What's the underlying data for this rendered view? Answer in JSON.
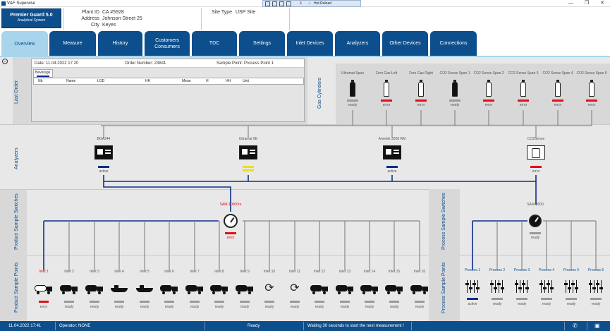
{
  "window": {
    "title": "V&F Supervise"
  },
  "debug_toolbar": {
    "count": "4",
    "hot_reload": "Hot Reload"
  },
  "header": {
    "logo_line1": "Premier Guard 5.0",
    "logo_line2": "Analytical System",
    "plant_id_label": "Plant ID",
    "plant_id_value": "CA #5928",
    "address_label": "Address",
    "address_value": "Johnson Street 25",
    "city_label": "City",
    "city_value": "Keyes",
    "site_type_label": "Site Type",
    "site_type_value": "USP Site"
  },
  "tabs": [
    {
      "label": "Overview",
      "active": true
    },
    {
      "label": "Measure"
    },
    {
      "label": "History"
    },
    {
      "label": "Customers Consumers"
    },
    {
      "label": "TDC"
    },
    {
      "label": "Settings"
    },
    {
      "label": "Inlet Devices"
    },
    {
      "label": "Analyzers"
    },
    {
      "label": "Other Devices"
    },
    {
      "label": "Connections"
    }
  ],
  "sections": {
    "last_order": "Last Order",
    "gas_cylinders": "Gas Cylinders",
    "analyzers": "Analyzers",
    "product_sample_switches": "Product Sample Switches",
    "product_sample_points": "Product Sample Points",
    "process_sample_switches": "Process Sample Switches",
    "process_sample_points": "Process Sample Points"
  },
  "last_order": {
    "date": "Date: 11.04.2022 17:20",
    "order_number": "Order Number: 23841",
    "sample_point": "Sample Point: Process Point 1",
    "tab_label": "Beverage",
    "columns": [
      "Nb",
      "Name",
      "LOD",
      "HH",
      "Mean",
      "H",
      "HH",
      "Unit"
    ]
  },
  "gas_cylinders": [
    {
      "name": "Ultramat Span",
      "status": "ready",
      "state": "grey",
      "dark": true
    },
    {
      "name": "Zero Gas Left",
      "status": "error",
      "state": "red",
      "dark": false
    },
    {
      "name": "Zero Gas Right",
      "status": "error",
      "state": "red",
      "dark": false
    },
    {
      "name": "CO2 Sense Span 1",
      "status": "ready",
      "state": "grey",
      "dark": true
    },
    {
      "name": "CO2 Sense Span 2",
      "status": "error",
      "state": "red",
      "dark": false
    },
    {
      "name": "CO2 Sense Span 3",
      "status": "error",
      "state": "red",
      "dark": false
    },
    {
      "name": "CO2 Sense Span 4",
      "status": "error",
      "state": "red",
      "dark": false
    },
    {
      "name": "CO2 Sense Span 5",
      "status": "error",
      "state": "red",
      "dark": false
    }
  ],
  "analyzers": [
    {
      "name": "BGA244",
      "status": "active",
      "state": "blue"
    },
    {
      "name": "Ultramat 6E",
      "status": "",
      "state": "yellow"
    },
    {
      "name": "Ametek 3050 RM",
      "status": "active",
      "state": "blue"
    },
    {
      "name": "CO2Sense",
      "status": "error",
      "state": "red"
    }
  ],
  "product_switch": {
    "name": "SAM-10000nr",
    "status": "error",
    "state": "red"
  },
  "process_switch": {
    "name": "SAM-3000",
    "status": "ready",
    "state": "grey"
  },
  "product_points": [
    {
      "name": "Inlet 1",
      "status": "error",
      "state": "red",
      "icon": "tanker-truck-icon"
    },
    {
      "name": "Inlet 2",
      "status": "ready",
      "state": "grey",
      "icon": "truck-icon"
    },
    {
      "name": "Inlet 3",
      "status": "ready",
      "state": "grey",
      "icon": "tanker-truck-icon"
    },
    {
      "name": "Inlet 4",
      "status": "ready",
      "state": "grey",
      "icon": "ship-icon"
    },
    {
      "name": "Inlet 5",
      "status": "ready",
      "state": "grey",
      "icon": "ship-icon"
    },
    {
      "name": "Inlet 6",
      "status": "ready",
      "state": "grey",
      "icon": "tractor-icon"
    },
    {
      "name": "Inlet 7",
      "status": "ready",
      "state": "grey",
      "icon": "train-icon"
    },
    {
      "name": "Inlet 8",
      "status": "ready",
      "state": "grey",
      "icon": "tanker-truck-icon"
    },
    {
      "name": "Inlet 9",
      "status": "ready",
      "state": "grey",
      "icon": "tanker-truck-icon"
    },
    {
      "name": "Inlet 10",
      "status": "ready",
      "state": "grey",
      "icon": "recycle-icon"
    },
    {
      "name": "Inlet 11",
      "status": "ready",
      "state": "grey",
      "icon": "recycle-icon"
    },
    {
      "name": "Inlet 12",
      "status": "ready",
      "state": "grey",
      "icon": "truck-icon"
    },
    {
      "name": "Inlet 13",
      "status": "ready",
      "state": "grey",
      "icon": "truck-icon"
    },
    {
      "name": "Inlet 14",
      "status": "ready",
      "state": "grey",
      "icon": "truck-icon"
    },
    {
      "name": "Inlet 15",
      "status": "ready",
      "state": "grey",
      "icon": "truck-icon"
    },
    {
      "name": "Inlet 16",
      "status": "ready",
      "state": "grey",
      "icon": "truck-icon"
    }
  ],
  "process_points": [
    {
      "name": "Process 1",
      "status": "active",
      "state": "blue"
    },
    {
      "name": "Process 2",
      "status": "ready",
      "state": "grey"
    },
    {
      "name": "Process 3",
      "status": "ready",
      "state": "grey"
    },
    {
      "name": "Process 4",
      "status": "ready",
      "state": "grey"
    },
    {
      "name": "Process 5",
      "status": "ready",
      "state": "grey"
    },
    {
      "name": "Process 6",
      "status": "ready",
      "state": "grey"
    }
  ],
  "status_bar": {
    "datetime": "11.04.2022 17:41",
    "operator": "Operator: NONE",
    "state": "Ready",
    "message": "Waiting 30 seconds to start the next measurement !"
  },
  "colors": {
    "brand": "#0d4e8c",
    "active": "#0d2d8c",
    "error": "#e0101a",
    "warning": "#e8e020",
    "ready": "#999999"
  }
}
